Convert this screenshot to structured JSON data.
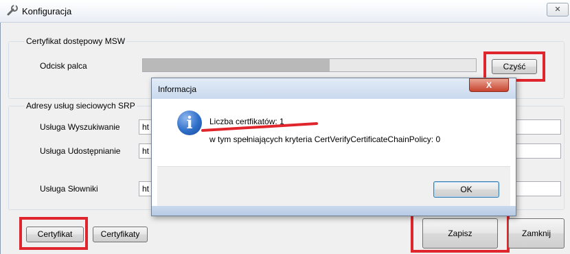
{
  "window": {
    "title": "Konfiguracja",
    "close_glyph": "✕"
  },
  "cert_group": {
    "label": "Certyfikat dostępowy MSW",
    "fingerprint_label": "Odcisk palca",
    "fingerprint_fill_fraction": 0.56,
    "clear_button": "Czyść"
  },
  "services_group": {
    "label": "Adresy usług sieciowych SRP",
    "rows": [
      {
        "label": "Usługa Wyszukiwanie",
        "value": "ht"
      },
      {
        "label": "Usługa Udostępnianie",
        "value": "ht"
      },
      {
        "label": "Usługa Słowniki",
        "value": "ht"
      }
    ]
  },
  "bottom": {
    "certyfikat_button": "Certyfikat",
    "certyfikaty_button": "Certyfikaty",
    "zapisz_button": "Zapisz",
    "zamknij_button": "Zamknij"
  },
  "dialog": {
    "title": "Informacja",
    "close_glyph": "X",
    "line1": "Liczba certfikatów: 1",
    "line2": "w tym spełniających kryteria CertVerifyCertificateChainPolicy: 0",
    "ok_button": "OK",
    "icon_glyph": "i"
  },
  "colors": {
    "highlight_red": "#e0262c",
    "info_blue": "#2f6fc9"
  }
}
